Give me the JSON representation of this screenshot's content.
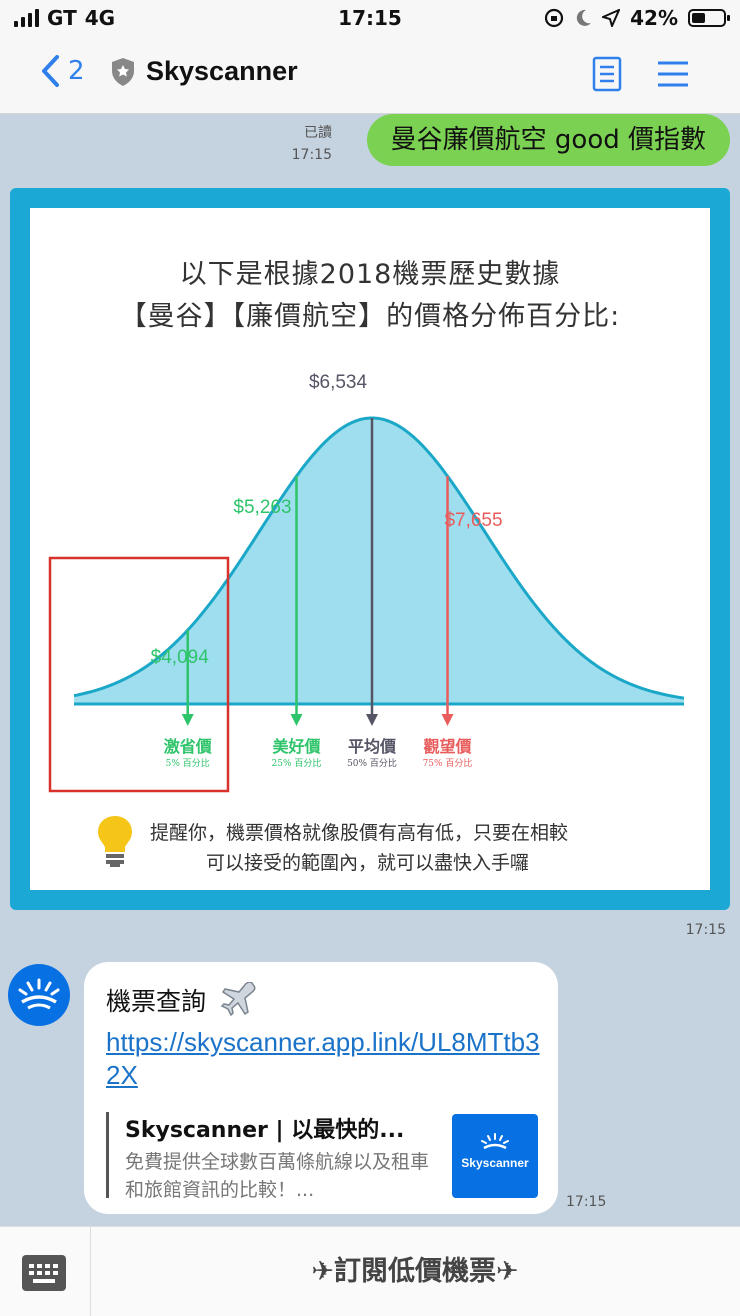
{
  "status_bar": {
    "carrier": "GT",
    "network": "4G",
    "time": "17:15",
    "battery": "42%",
    "battery_level": 0.42
  },
  "nav": {
    "back_count": "2",
    "title": "Skyscanner"
  },
  "outgoing": {
    "read_label": "已讀",
    "time": "17:15",
    "text": "曼谷廉價航空 good 價指數"
  },
  "image_message": {
    "title_line1": "以下是根據2018機票歷史數據",
    "title_line2": "【曼谷】【廉價航空】的價格分佈百分比:",
    "tip_line1": "提醒你，機票價格就像股價有高有低，只要在相較",
    "tip_line2": "可以接受的範圍內，就可以盡快入手囉",
    "time": "17:15"
  },
  "chart_data": {
    "type": "area",
    "markers": [
      {
        "price": "$4,094",
        "label": "激省價",
        "sub": "5% 百分比",
        "percentile": 5,
        "color": "#2ec46a"
      },
      {
        "price": "$5,263",
        "label": "美好價",
        "sub": "25% 百分比",
        "percentile": 25,
        "color": "#2ec46a"
      },
      {
        "price": "$6,534",
        "label": "平均價",
        "sub": "50% 百分比",
        "percentile": 50,
        "color": "#555566"
      },
      {
        "price": "$7,655",
        "label": "觀望價",
        "sub": "75% 百分比",
        "percentile": 75,
        "color": "#e85c5c"
      }
    ],
    "fill_color": "#9fdeef",
    "line_color": "#1ba8c8",
    "highlight_color": "#d9322c"
  },
  "incoming": {
    "head": "機票查詢",
    "link": "https://skyscanner.app.link/UL8MTtb32X",
    "preview_title": "Skyscanner | 以最快的...",
    "preview_desc": "免費提供全球數百萬條航線以及租車和旅館資訊的比較！...",
    "thumb_brand": "Skyscanner",
    "time": "17:15"
  },
  "bottom": {
    "subscribe": "✈訂閱低價機票✈"
  },
  "colors": {
    "accent": "#2f80ed",
    "bubble_out": "#7bd151",
    "frame": "#1ba8d4",
    "brand": "#0770e3"
  }
}
